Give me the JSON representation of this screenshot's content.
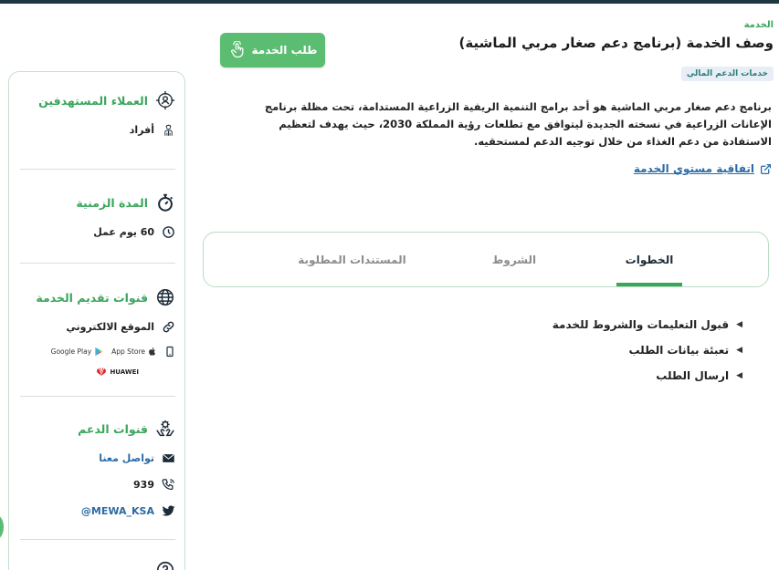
{
  "header": {
    "service_label": "الخدمة",
    "title": "وصف الخدمة (برنامج دعم صغار مربي الماشية)",
    "tag": "خدمات الدعم المالي",
    "request_button": "طلب الخدمة"
  },
  "description": "برنامج دعم صغار مربي الماشية هو أحد برامج التنمية الريفية الزراعية المستدامة، تحت مظلة برنامج الإعانات الزراعية في نسخته الجديدة ليتوافق مع تطلعات رؤية المملكة 2030، حيث يهدف لتعظيم الاستفادة من دعم الغذاء من خلال توجيه الدعم لمستحقيه.",
  "sla_link": "اتفاقية مستوي الخدمة",
  "tabs": [
    {
      "label": "الخطوات",
      "active": true
    },
    {
      "label": "الشروط",
      "active": false
    },
    {
      "label": "المستندات المطلوبة",
      "active": false
    }
  ],
  "steps": [
    "قبول التعليمات والشروط للخدمة",
    "تعبئة بيانات الطلب",
    "ارسال الطلب"
  ],
  "sidebar": {
    "beneficiaries": {
      "title": "العملاء المستهدفين",
      "value": "أفراد"
    },
    "duration": {
      "title": "المدة الزمنية",
      "value": "60 يوم عمل"
    },
    "channels": {
      "title": "قنوات تقديم الخدمة",
      "website": "الموقع الالكتروني",
      "google_play": "Google Play",
      "app_store": "App Store",
      "huawei": "HUAWEI"
    },
    "support": {
      "title": "قنوات الدعم",
      "contact": "تواصل معنا",
      "phone": "939",
      "twitter": "MEWA_KSA@"
    }
  },
  "colors": {
    "accent_green": "#3aa65b",
    "button_green": "#5bbd72",
    "link_blue": "#2b6aa3",
    "tag_bg": "#e7eef5"
  }
}
